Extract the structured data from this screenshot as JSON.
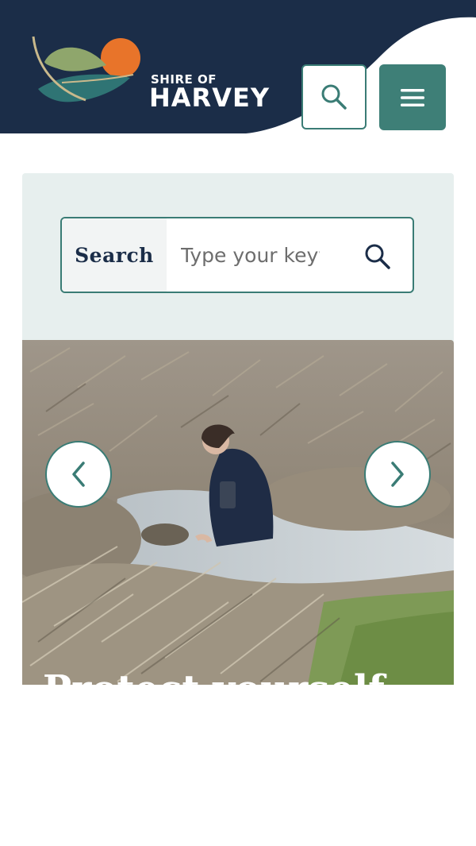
{
  "header": {
    "logo": {
      "line1": "SHIRE OF",
      "line2": "HARVEY"
    },
    "search_button_icon": "search-icon",
    "menu_button_icon": "hamburger-menu-icon"
  },
  "search": {
    "label": "Search",
    "placeholder": "Type your keyword",
    "submit_icon": "search-icon"
  },
  "hero": {
    "prev_icon": "chevron-left-icon",
    "next_icon": "chevron-right-icon",
    "caption": "Protect yourself"
  },
  "colors": {
    "navy": "#1b2d48",
    "teal": "#3e7f77",
    "panel": "#e7efee",
    "orange": "#e8742a"
  }
}
